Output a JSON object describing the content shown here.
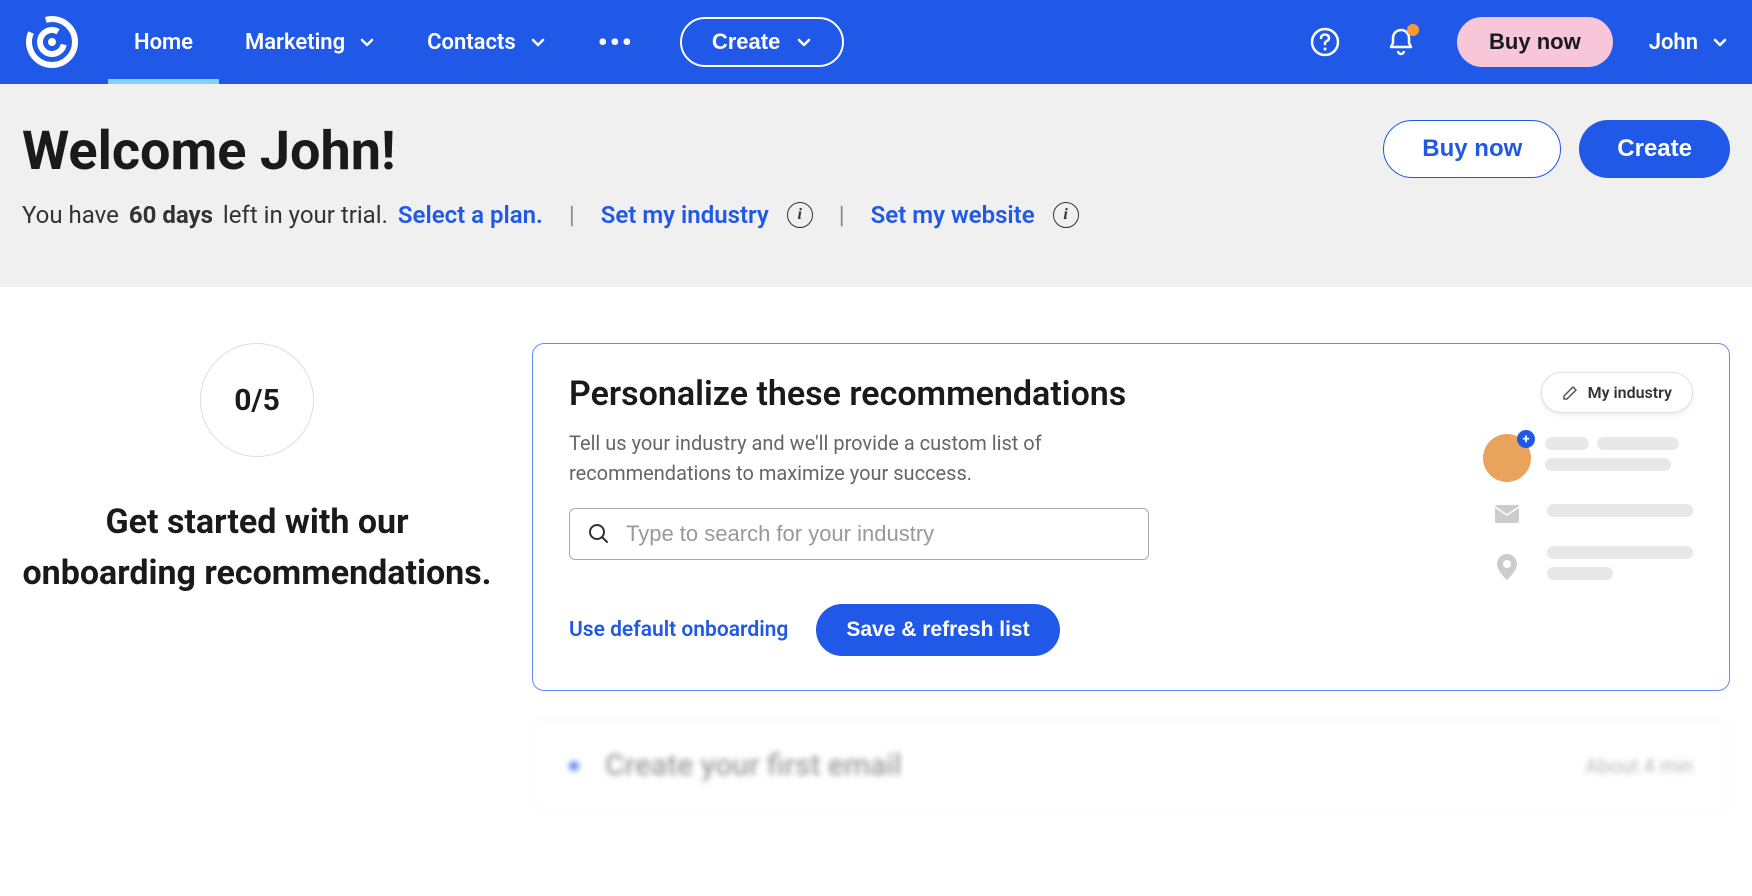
{
  "nav": {
    "home": "Home",
    "marketing": "Marketing",
    "contacts": "Contacts",
    "create": "Create",
    "buy_now": "Buy now",
    "user": "John"
  },
  "header": {
    "welcome": "Welcome John!",
    "trial_prefix": "You have ",
    "trial_days": "60 days",
    "trial_suffix": " left in your trial. ",
    "select_plan": "Select a plan.",
    "set_industry": "Set my industry",
    "set_website": "Set my website",
    "buy_now": "Buy now",
    "create": "Create"
  },
  "onboarding": {
    "progress": "0/5",
    "heading": "Get started with our onboarding recommendations."
  },
  "personalize": {
    "title": "Personalize these recommendations",
    "desc": "Tell us your industry and we'll provide a custom list of recommendations to maximize your success.",
    "placeholder": "Type to search for your industry",
    "default_link": "Use default onboarding",
    "save": "Save & refresh list",
    "badge": "My industry"
  },
  "next": {
    "title": "Create your first email",
    "time": "About 4 min"
  }
}
